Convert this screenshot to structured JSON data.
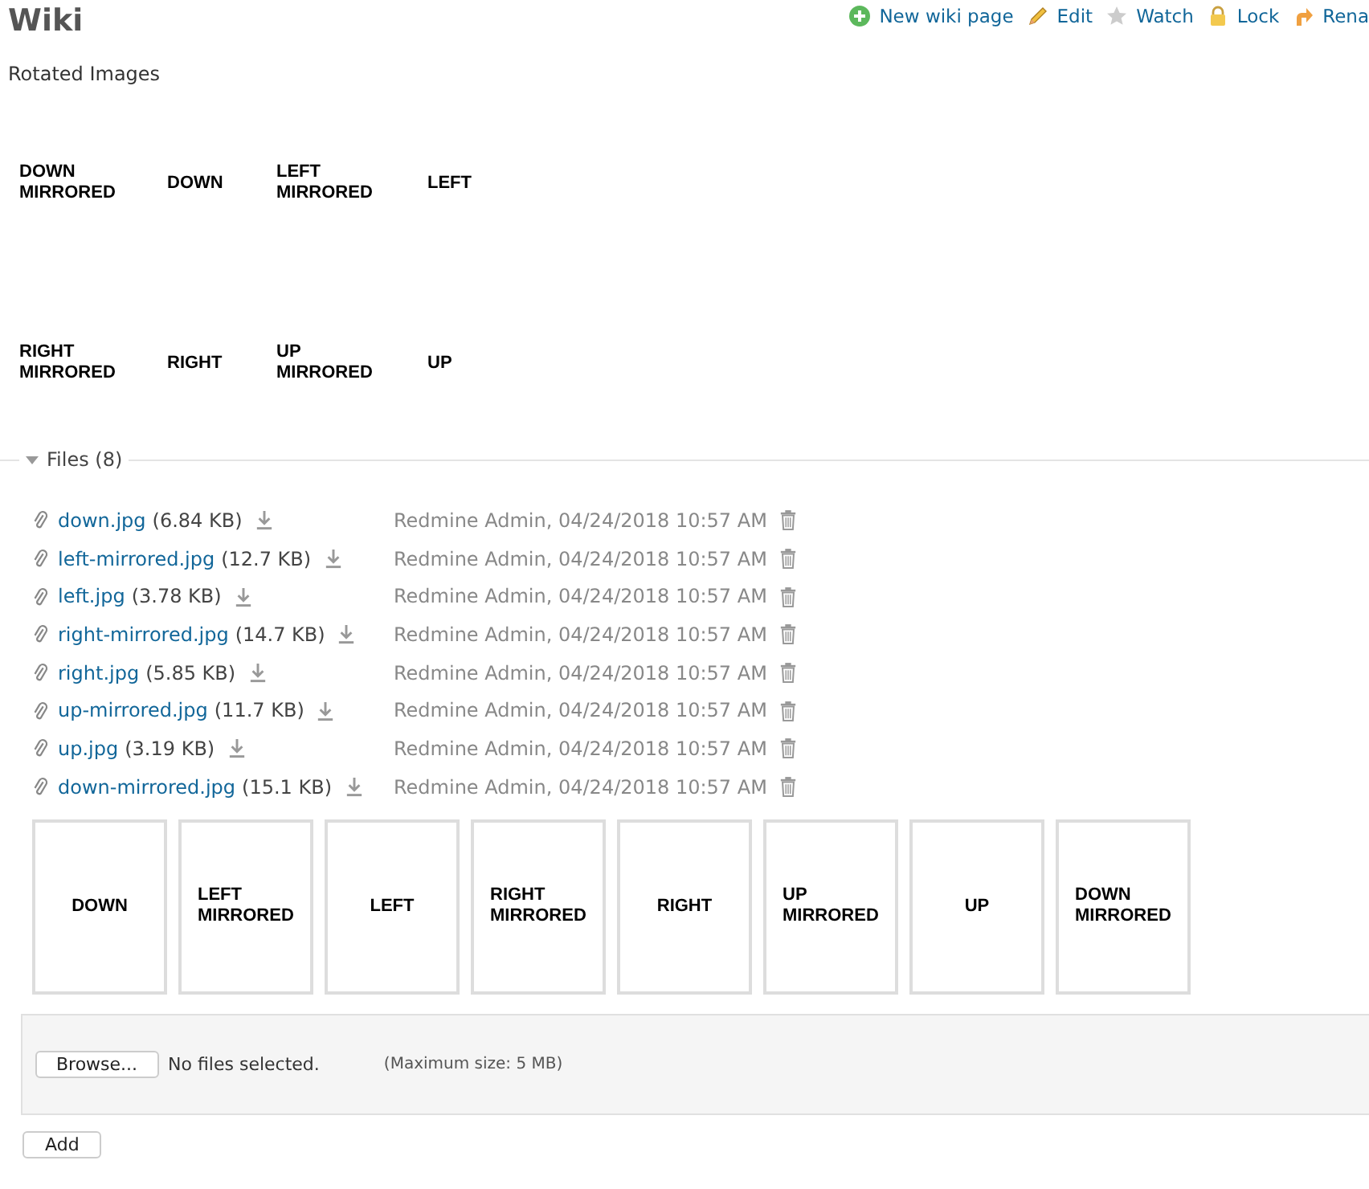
{
  "title": "Wiki",
  "actions": [
    {
      "kind": "add",
      "label": "New wiki page"
    },
    {
      "kind": "edit",
      "label": "Edit"
    },
    {
      "kind": "watch",
      "label": "Watch"
    },
    {
      "kind": "lock",
      "label": "Lock"
    },
    {
      "kind": "rename",
      "label": "Rena"
    }
  ],
  "heading": "Rotated Images",
  "images": [
    {
      "text": "DOWN MIRRORED"
    },
    {
      "text": "DOWN"
    },
    {
      "text": "LEFT MIRRORED"
    },
    {
      "text": "LEFT"
    },
    {
      "text": "RIGHT MIRRORED"
    },
    {
      "text": "RIGHT"
    },
    {
      "text": "UP MIRRORED"
    },
    {
      "text": "UP"
    }
  ],
  "files": {
    "legend": "Files (8)",
    "expanded": true,
    "rows": [
      {
        "name": "down.jpg",
        "size": "(6.84 KB)",
        "author": "Redmine Admin, 04/24/2018 10:57 AM"
      },
      {
        "name": "left-mirrored.jpg",
        "size": "(12.7 KB)",
        "author": "Redmine Admin, 04/24/2018 10:57 AM"
      },
      {
        "name": "left.jpg",
        "size": "(3.78 KB)",
        "author": "Redmine Admin, 04/24/2018 10:57 AM"
      },
      {
        "name": "right-mirrored.jpg",
        "size": "(14.7 KB)",
        "author": "Redmine Admin, 04/24/2018 10:57 AM"
      },
      {
        "name": "right.jpg",
        "size": "(5.85 KB)",
        "author": "Redmine Admin, 04/24/2018 10:57 AM"
      },
      {
        "name": "up-mirrored.jpg",
        "size": "(11.7 KB)",
        "author": "Redmine Admin, 04/24/2018 10:57 AM"
      },
      {
        "name": "up.jpg",
        "size": "(3.19 KB)",
        "author": "Redmine Admin, 04/24/2018 10:57 AM"
      },
      {
        "name": "down-mirrored.jpg",
        "size": "(15.1 KB)",
        "author": "Redmine Admin, 04/24/2018 10:57 AM"
      }
    ],
    "thumbnails": [
      {
        "text": "DOWN"
      },
      {
        "text": "LEFT MIRRORED"
      },
      {
        "text": "LEFT"
      },
      {
        "text": "RIGHT MIRRORED"
      },
      {
        "text": "RIGHT"
      },
      {
        "text": "UP MIRRORED"
      },
      {
        "text": "UP"
      },
      {
        "text": "DOWN MIRRORED"
      }
    ]
  },
  "upload": {
    "browse": "Browse...",
    "status": "No files selected.",
    "hint": "(Maximum size: 5 MB)",
    "add": "Add"
  }
}
